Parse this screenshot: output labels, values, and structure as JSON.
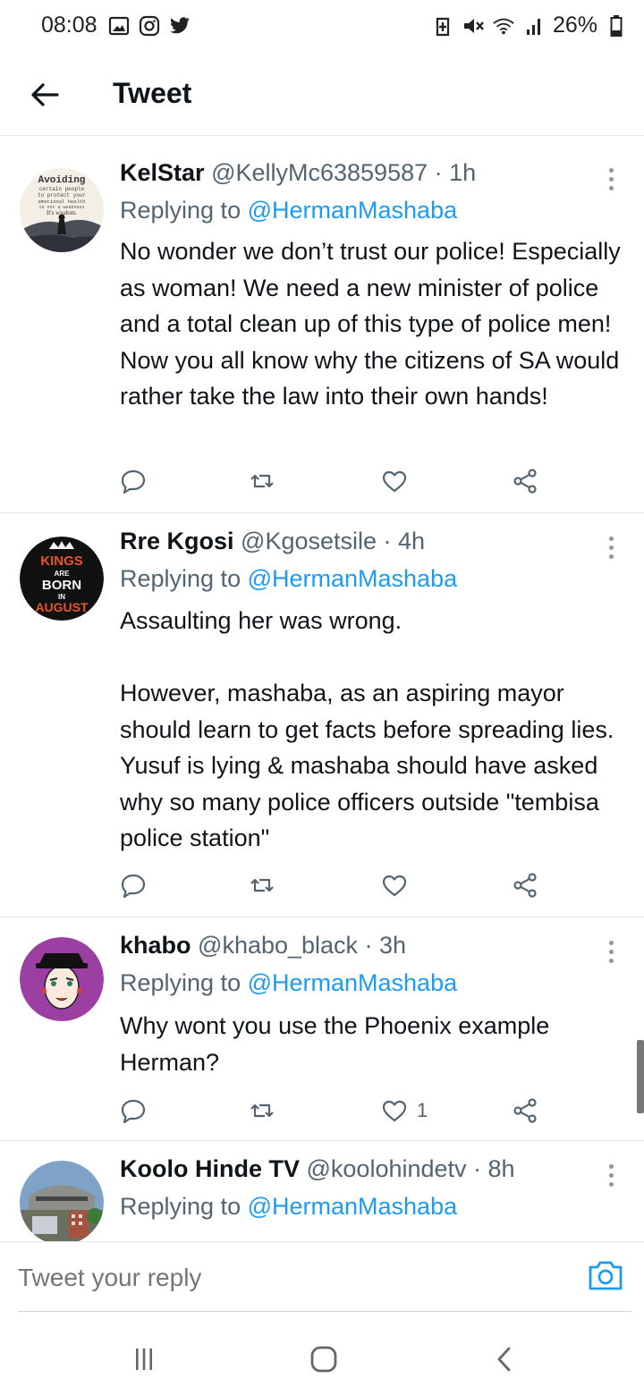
{
  "status_bar": {
    "time": "08:08",
    "battery": "26%",
    "icons": [
      "gallery-icon",
      "instagram-icon",
      "twitter-icon",
      "saver-icon",
      "mute-icon",
      "wifi-icon",
      "signal-icon",
      "battery-icon"
    ]
  },
  "header": {
    "title": "Tweet",
    "back_icon": "back-arrow-icon"
  },
  "tweets": [
    {
      "name": "KelStar",
      "handle": "@KellyMc63859587 · 1h",
      "reply_prefix": "Replying to ",
      "reply_mention": "@HermanMashaba",
      "text": "No wonder we don’t trust our police! Especially as woman! We need a new minister of police and a total clean up of this type of police men! Now you all know why the citizens of SA would rather take the law into their own hands!",
      "likes": "",
      "avatar_text": [
        "Avoiding",
        "certain people",
        "to protect your",
        "emotional health",
        "is not a weakness",
        "It's wisdom."
      ]
    },
    {
      "name": "Rre Kgosi",
      "handle": "@Kgosetsile · 4h",
      "reply_prefix": "Replying to ",
      "reply_mention": "@HermanMashaba",
      "text": "Assaulting her was wrong.\n\nHowever, mashaba, as an aspiring mayor should learn to get facts before spreading lies. Yusuf is lying & mashaba should have asked why so many police officers outside \"tembisa police station\"",
      "likes": "",
      "avatar_text": [
        "KINGS",
        "ARE",
        "BORN",
        "IN",
        "AUGUST"
      ]
    },
    {
      "name": "khabo",
      "handle": "@khabo_black · 3h",
      "reply_prefix": "Replying to ",
      "reply_mention": "@HermanMashaba",
      "text": "Why wont you use the Phoenix example Herman?",
      "likes": "1"
    },
    {
      "name": "Koolo Hinde TV",
      "handle": "@koolohindetv · 8h",
      "reply_prefix": "Replying to ",
      "reply_mention": "@HermanMashaba",
      "text": "",
      "likes": ""
    }
  ],
  "composer": {
    "placeholder": "Tweet your reply",
    "camera_icon": "camera-icon"
  },
  "navbar": {
    "icons": [
      "recent-apps-icon",
      "home-icon",
      "back-icon"
    ]
  },
  "colors": {
    "accent": "#1d9bf0",
    "secondary_text": "#536471",
    "primary_text": "#0f1419",
    "divider": "#e1e6ea"
  }
}
